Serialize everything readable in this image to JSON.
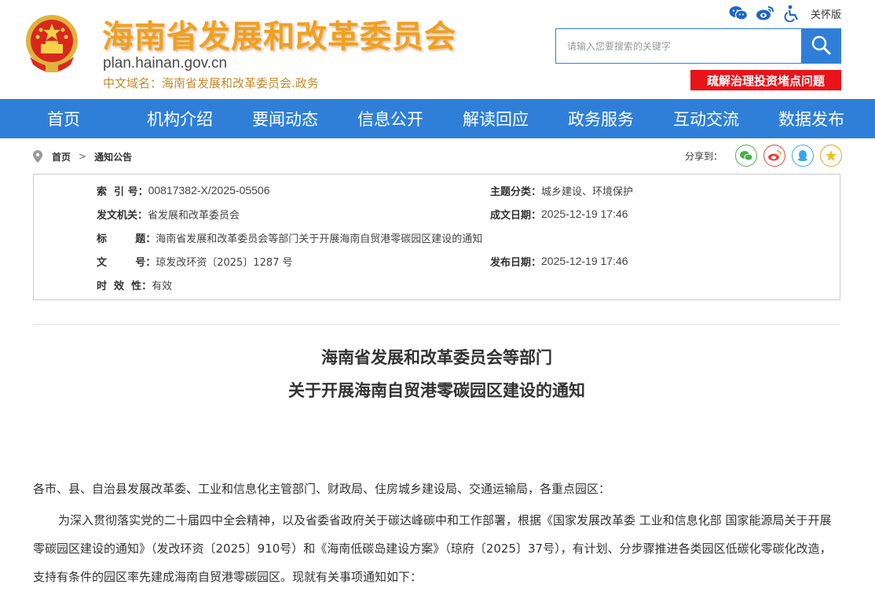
{
  "header": {
    "site_title": "海南省发展和改革委员会",
    "domain": "plan.hainan.gov.cn",
    "cn_domain": "中文域名：海南省发展和改革委员会.政务",
    "care_mode": "关怀版",
    "search_placeholder": "请输入您要搜索的关键字",
    "promo_banner": "疏解治理投资堵点问题"
  },
  "nav": {
    "items": [
      "首页",
      "机构介绍",
      "要闻动态",
      "信息公开",
      "解读回应",
      "政务服务",
      "互动交流",
      "数据发布"
    ]
  },
  "breadcrumb": {
    "home": "首页",
    "separator": ">",
    "current": "通知公告",
    "share_label": "分享到："
  },
  "meta": {
    "index_label": "索  引 号：",
    "index_value": "00817382-X/2025-05506",
    "topic_label": "主题分类：",
    "topic_value": "城乡建设、环境保护",
    "issuer_label": "发文机关：",
    "issuer_value": "省发展和改革委员会",
    "created_label": "成文日期：",
    "created_value": "2025-12-19 17:46",
    "title_label": "标        题：",
    "title_value": "海南省发展和改革委员会等部门关于开展海南自贸港零碳园区建设的通知",
    "docno_label": "文        号：",
    "docno_value": "琼发改环资〔2025〕1287 号",
    "published_label": "发布日期：",
    "published_value": "2025-12-19 17:46",
    "validity_label": "时  效  性：",
    "validity_value": "有效"
  },
  "document": {
    "title_line1": "海南省发展和改革委员会等部门",
    "title_line2": "关于开展海南自贸港零碳园区建设的通知",
    "para1": "各市、县、自治县发展改革委、工业和信息化主管部门、财政局、住房城乡建设局、交通运输局，各重点园区：",
    "para2": "为深入贯彻落实党的二十届四中全会精神，以及省委省政府关于碳达峰碳中和工作部署，根据《国家发展改革委 工业和信息化部 国家能源局关于开展零碳园区建设的通知》（发改环资〔2025〕910号）和《海南低碳岛建设方案》（琼府〔2025〕37号），有计划、分步骤推进各类园区低碳化零碳化改造，支持有条件的园区率先建成海南自贸港零碳园区。现就有关事项通知如下："
  },
  "colors": {
    "nav_blue": "#2f7fd9",
    "title_orange": "#f0a020",
    "banner_red": "#e8141a"
  },
  "icons": [
    "emblem-icon",
    "wechat-icon",
    "weibo-icon",
    "accessibility-icon",
    "search-icon",
    "location-pin-icon",
    "share-wechat-icon",
    "share-weibo-icon",
    "share-qq-icon",
    "share-favorite-icon"
  ]
}
